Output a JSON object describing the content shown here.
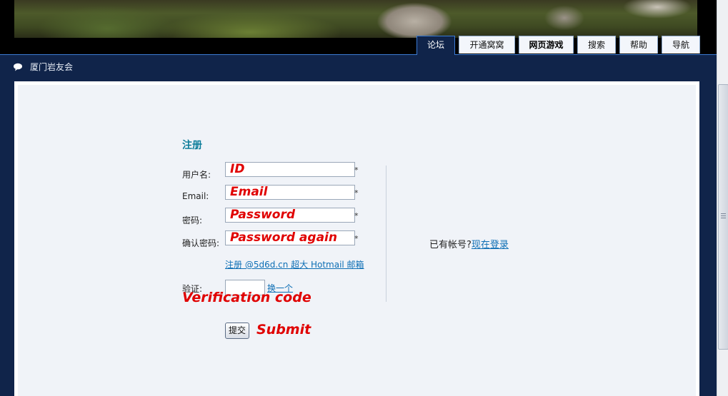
{
  "nav": {
    "tabs": [
      {
        "label": "论坛",
        "active": true
      },
      {
        "label": "开通窝窝"
      },
      {
        "label": "网页游戏",
        "bold": true
      },
      {
        "label": "搜索"
      },
      {
        "label": "帮助"
      },
      {
        "label": "导航"
      }
    ]
  },
  "breadcrumb": {
    "icon": "speech-bubble-icon",
    "label": "厦门岩友会"
  },
  "form": {
    "title": "注册",
    "username_label": "用户名:",
    "email_label": "Email:",
    "password_label": "密码:",
    "confirm_label": "确认密码:",
    "required_mark": "*",
    "hotmail_link": "注册 @5d6d.cn 超大 Hotmail 邮箱",
    "captcha_label": "验证:",
    "captcha_refresh": "换一个",
    "submit_label": "提交"
  },
  "annotations": {
    "id": "ID",
    "email": "Email",
    "password": "Password",
    "password_again": "Password again",
    "verification": "Verification code",
    "submit": "Submit"
  },
  "login": {
    "prompt": "已有帐号?",
    "link": "现在登录"
  },
  "colors": {
    "background": "#10244a",
    "accent": "#0c7d9a",
    "annotation": "#e00000",
    "link": "#0e6fb5"
  }
}
